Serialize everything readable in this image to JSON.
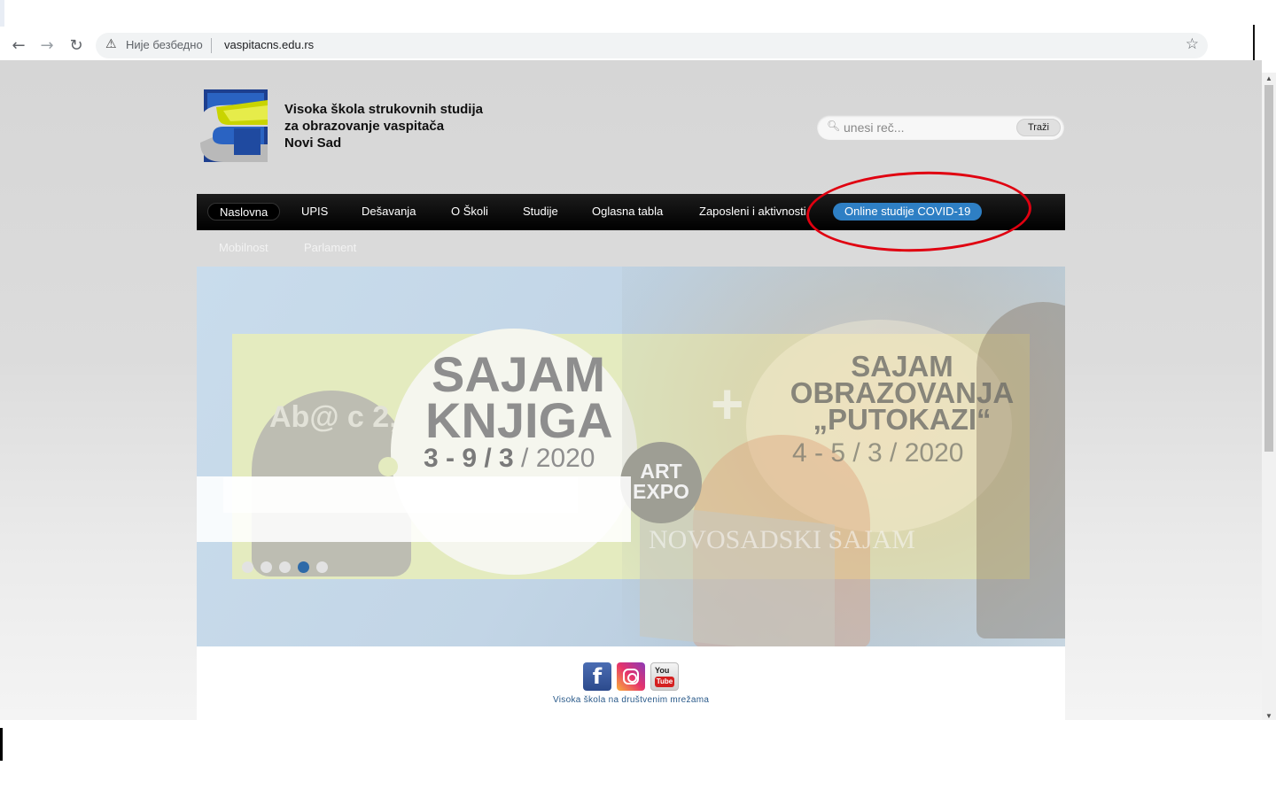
{
  "browser": {
    "back_icon": "arrow-left-icon",
    "forward_icon": "arrow-right-icon",
    "reload_icon": "reload-icon",
    "security_label": "Није безбедно",
    "url": "vaspitacns.edu.rs",
    "bookmark_icon": "star-icon"
  },
  "header": {
    "school_name_line1": "Visoka škola strukovnih studija",
    "school_name_line2": "za obrazovanje vaspitača",
    "school_name_line3": "Novi Sad",
    "search_placeholder": "unesi reč...",
    "search_button": "Traži"
  },
  "nav": {
    "items": [
      {
        "label": "Naslovna",
        "active": true
      },
      {
        "label": "UPIS"
      },
      {
        "label": "Dešavanja"
      },
      {
        "label": "O Školi"
      },
      {
        "label": "Studije"
      },
      {
        "label": "Oglasna tabla"
      },
      {
        "label": "Zaposleni i aktivnosti"
      },
      {
        "label": "Online studije COVID-19",
        "highlight": true
      }
    ],
    "subitems": [
      {
        "label": "Mobilnost"
      },
      {
        "label": "Parlament"
      }
    ],
    "highlight_color": "#2e7fc4",
    "annotation_color": "#e00010"
  },
  "banner": {
    "sajam_knjiga": "SAJAM KNJIGA",
    "knjiga_date_bold": "3 - 9 / 3",
    "knjiga_date_year": " / 2020",
    "art_expo": "ART EXPO",
    "sajam_obrazovanja": "SAJAM OBRAZOVANJA „PUTOKAZI“",
    "obrazovanja_date": "4 - 5 / 3 / 2020",
    "novosadski": "NOVOSADSKI SAJAM",
    "plus": "+",
    "ab_text": "Ab@ c 2„",
    "slide_count": 5,
    "active_slide": 4
  },
  "social": {
    "caption": "Visoka škola na društvenim mrežama",
    "facebook_letter": "f",
    "youtube_you": "You",
    "youtube_tube": "Tube"
  }
}
